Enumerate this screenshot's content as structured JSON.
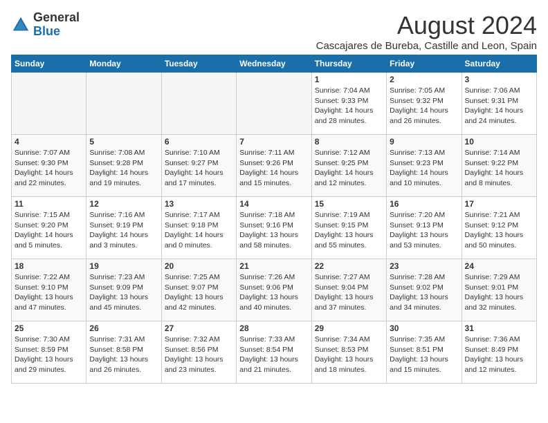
{
  "logo": {
    "general": "General",
    "blue": "Blue"
  },
  "title": "August 2024",
  "location": "Cascajares de Bureba, Castille and Leon, Spain",
  "headers": [
    "Sunday",
    "Monday",
    "Tuesday",
    "Wednesday",
    "Thursday",
    "Friday",
    "Saturday"
  ],
  "weeks": [
    [
      {
        "day": "",
        "info": ""
      },
      {
        "day": "",
        "info": ""
      },
      {
        "day": "",
        "info": ""
      },
      {
        "day": "",
        "info": ""
      },
      {
        "day": "1",
        "info": "Sunrise: 7:04 AM\nSunset: 9:33 PM\nDaylight: 14 hours\nand 28 minutes."
      },
      {
        "day": "2",
        "info": "Sunrise: 7:05 AM\nSunset: 9:32 PM\nDaylight: 14 hours\nand 26 minutes."
      },
      {
        "day": "3",
        "info": "Sunrise: 7:06 AM\nSunset: 9:31 PM\nDaylight: 14 hours\nand 24 minutes."
      }
    ],
    [
      {
        "day": "4",
        "info": "Sunrise: 7:07 AM\nSunset: 9:30 PM\nDaylight: 14 hours\nand 22 minutes."
      },
      {
        "day": "5",
        "info": "Sunrise: 7:08 AM\nSunset: 9:28 PM\nDaylight: 14 hours\nand 19 minutes."
      },
      {
        "day": "6",
        "info": "Sunrise: 7:10 AM\nSunset: 9:27 PM\nDaylight: 14 hours\nand 17 minutes."
      },
      {
        "day": "7",
        "info": "Sunrise: 7:11 AM\nSunset: 9:26 PM\nDaylight: 14 hours\nand 15 minutes."
      },
      {
        "day": "8",
        "info": "Sunrise: 7:12 AM\nSunset: 9:25 PM\nDaylight: 14 hours\nand 12 minutes."
      },
      {
        "day": "9",
        "info": "Sunrise: 7:13 AM\nSunset: 9:23 PM\nDaylight: 14 hours\nand 10 minutes."
      },
      {
        "day": "10",
        "info": "Sunrise: 7:14 AM\nSunset: 9:22 PM\nDaylight: 14 hours\nand 8 minutes."
      }
    ],
    [
      {
        "day": "11",
        "info": "Sunrise: 7:15 AM\nSunset: 9:20 PM\nDaylight: 14 hours\nand 5 minutes."
      },
      {
        "day": "12",
        "info": "Sunrise: 7:16 AM\nSunset: 9:19 PM\nDaylight: 14 hours\nand 3 minutes."
      },
      {
        "day": "13",
        "info": "Sunrise: 7:17 AM\nSunset: 9:18 PM\nDaylight: 14 hours\nand 0 minutes."
      },
      {
        "day": "14",
        "info": "Sunrise: 7:18 AM\nSunset: 9:16 PM\nDaylight: 13 hours\nand 58 minutes."
      },
      {
        "day": "15",
        "info": "Sunrise: 7:19 AM\nSunset: 9:15 PM\nDaylight: 13 hours\nand 55 minutes."
      },
      {
        "day": "16",
        "info": "Sunrise: 7:20 AM\nSunset: 9:13 PM\nDaylight: 13 hours\nand 53 minutes."
      },
      {
        "day": "17",
        "info": "Sunrise: 7:21 AM\nSunset: 9:12 PM\nDaylight: 13 hours\nand 50 minutes."
      }
    ],
    [
      {
        "day": "18",
        "info": "Sunrise: 7:22 AM\nSunset: 9:10 PM\nDaylight: 13 hours\nand 47 minutes."
      },
      {
        "day": "19",
        "info": "Sunrise: 7:23 AM\nSunset: 9:09 PM\nDaylight: 13 hours\nand 45 minutes."
      },
      {
        "day": "20",
        "info": "Sunrise: 7:25 AM\nSunset: 9:07 PM\nDaylight: 13 hours\nand 42 minutes."
      },
      {
        "day": "21",
        "info": "Sunrise: 7:26 AM\nSunset: 9:06 PM\nDaylight: 13 hours\nand 40 minutes."
      },
      {
        "day": "22",
        "info": "Sunrise: 7:27 AM\nSunset: 9:04 PM\nDaylight: 13 hours\nand 37 minutes."
      },
      {
        "day": "23",
        "info": "Sunrise: 7:28 AM\nSunset: 9:02 PM\nDaylight: 13 hours\nand 34 minutes."
      },
      {
        "day": "24",
        "info": "Sunrise: 7:29 AM\nSunset: 9:01 PM\nDaylight: 13 hours\nand 32 minutes."
      }
    ],
    [
      {
        "day": "25",
        "info": "Sunrise: 7:30 AM\nSunset: 8:59 PM\nDaylight: 13 hours\nand 29 minutes."
      },
      {
        "day": "26",
        "info": "Sunrise: 7:31 AM\nSunset: 8:58 PM\nDaylight: 13 hours\nand 26 minutes."
      },
      {
        "day": "27",
        "info": "Sunrise: 7:32 AM\nSunset: 8:56 PM\nDaylight: 13 hours\nand 23 minutes."
      },
      {
        "day": "28",
        "info": "Sunrise: 7:33 AM\nSunset: 8:54 PM\nDaylight: 13 hours\nand 21 minutes."
      },
      {
        "day": "29",
        "info": "Sunrise: 7:34 AM\nSunset: 8:53 PM\nDaylight: 13 hours\nand 18 minutes."
      },
      {
        "day": "30",
        "info": "Sunrise: 7:35 AM\nSunset: 8:51 PM\nDaylight: 13 hours\nand 15 minutes."
      },
      {
        "day": "31",
        "info": "Sunrise: 7:36 AM\nSunset: 8:49 PM\nDaylight: 13 hours\nand 12 minutes."
      }
    ]
  ]
}
